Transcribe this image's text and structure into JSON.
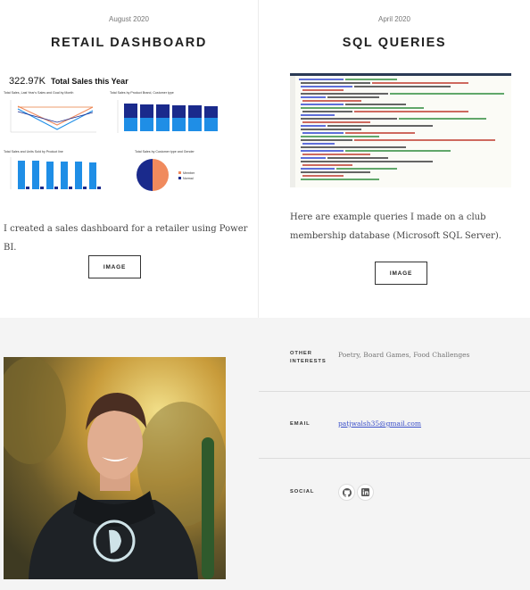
{
  "projects": [
    {
      "date": "August 2020",
      "title": "RETAIL DASHBOARD",
      "description": "I created a sales dashboard for a retailer using Power BI.",
      "button_label": "IMAGE",
      "dashboard": {
        "kpi_value": "322.97K",
        "kpi_label": "Total Sales this Year",
        "chart1_title": "Total Sales, Last Year's Sales and Goal by Month",
        "chart2_title": "Total Sales by Product Brand, Customer type",
        "chart3_title": "Total Sales and Units Sold by Product line",
        "chart4_title": "Total Sales by Customer type and Gender",
        "pie_legend_1": "Member",
        "pie_legend_2": "Normal"
      }
    },
    {
      "date": "April 2020",
      "title": "SQL QUERIES",
      "description": "Here are example queries I made on a club membership database (Microsoft SQL Server).",
      "button_label": "IMAGE"
    }
  ],
  "about": {
    "other_interests_label": "OTHER INTERESTS",
    "other_interests_value": "Poetry, Board Games, Food Challenges",
    "email_label": "EMAIL",
    "email_value": "patjwalsh35@gmail.com",
    "social_label": "SOCIAL",
    "social_icons": [
      "github-icon",
      "linkedin-icon"
    ]
  },
  "colors": {
    "accent_blue": "#1f8ee6",
    "navy": "#1a2a8c",
    "orange": "#f08a5d",
    "link": "#3a4fc9"
  }
}
